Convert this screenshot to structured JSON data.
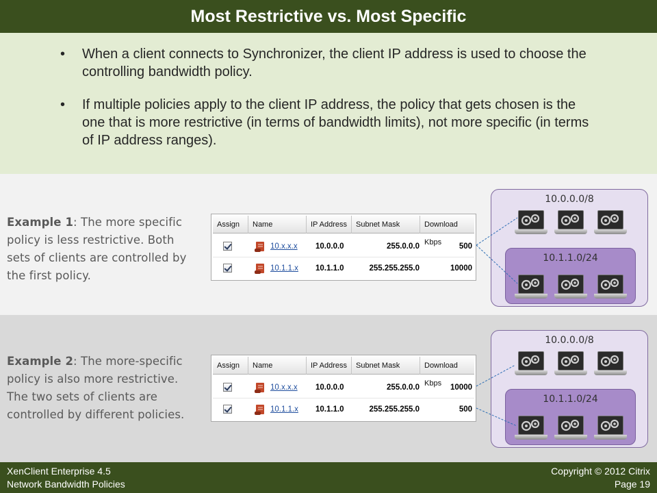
{
  "slide": {
    "title": "Most Restrictive vs. Most Specific",
    "bullets": [
      "When a client connects to Synchronizer, the client IP address is used to choose the controlling bandwidth policy.",
      "If multiple policies apply to the client IP address, the policy that gets chosen is the one that is more restrictive (in terms of bandwidth limits), not more specific (in terms of IP address ranges)."
    ],
    "bullet_glyph": "•"
  },
  "table_headers": {
    "assign": "Assign",
    "name": "Name",
    "ip": "IP Address",
    "mask": "Subnet Mask",
    "kbps": "Download Kbps"
  },
  "example1": {
    "label": "Example 1",
    "text": ": The more specific policy is less restrictive.  Both sets of clients are controlled by the first policy.",
    "rows": [
      {
        "name": "10.x.x.x",
        "ip": "10.0.0.0",
        "mask": "255.0.0.0",
        "kbps": "500",
        "assigned": true
      },
      {
        "name": "10.1.1.x",
        "ip": "10.1.1.0",
        "mask": "255.255.255.0",
        "kbps": "10000",
        "assigned": true
      }
    ],
    "outer_network": "10.0.0.0/8",
    "inner_network": "10.1.1.0/24"
  },
  "example2": {
    "label": "Example 2",
    "text": ": The more-specific policy is also more restrictive.  The two sets of clients are controlled by different policies.",
    "rows": [
      {
        "name": "10.x.x.x",
        "ip": "10.0.0.0",
        "mask": "255.0.0.0",
        "kbps": "10000",
        "assigned": true
      },
      {
        "name": "10.1.1.x",
        "ip": "10.1.1.0",
        "mask": "255.255.255.0",
        "kbps": "500",
        "assigned": true
      }
    ],
    "outer_network": "10.0.0.0/8",
    "inner_network": "10.1.1.0/24"
  },
  "icons": {
    "policy": "policy-scroll-icon",
    "client": "laptop-gear-icon",
    "assign": "checkbox-checked-icon"
  },
  "colors": {
    "title_bar": "#3a4f1e",
    "intro_bg": "#e3ecd3",
    "network_outer": "#e6dff0",
    "network_inner": "#a78bc9",
    "link": "#1f4e9e",
    "connector": "#2e6fb5"
  },
  "footer": {
    "left_line1": "XenClient Enterprise 4.5",
    "left_line2": "Network Bandwidth Policies",
    "right_line1": "Copyright © 2012 Citrix",
    "right_line2": "Page 19"
  }
}
